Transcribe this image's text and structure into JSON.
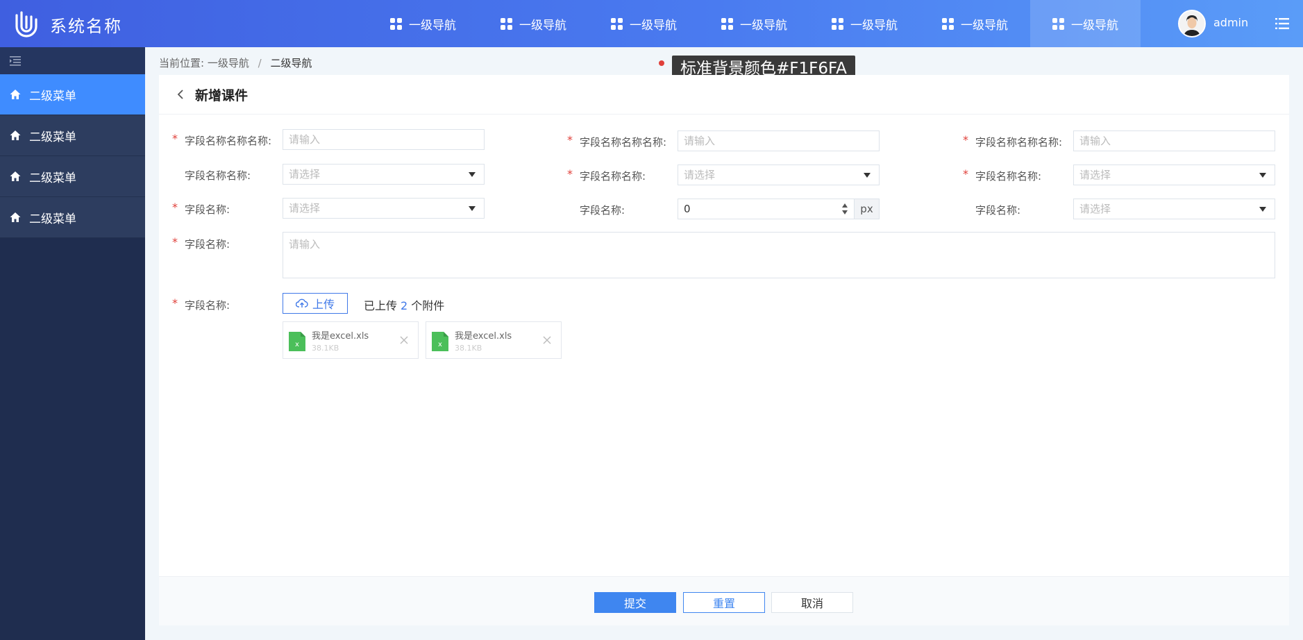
{
  "header": {
    "app_title": "系统名称",
    "nav": [
      {
        "label": "一级导航"
      },
      {
        "label": "一级导航"
      },
      {
        "label": "一级导航"
      },
      {
        "label": "一级导航"
      },
      {
        "label": "一级导航"
      },
      {
        "label": "一级导航"
      },
      {
        "label": "一级导航",
        "active": true
      }
    ],
    "username": "admin"
  },
  "sidebar": {
    "items": [
      {
        "label": "二级菜单",
        "active": true
      },
      {
        "label": "二级菜单"
      },
      {
        "label": "二级菜单"
      },
      {
        "label": "二级菜单"
      }
    ]
  },
  "breadcrumb": {
    "prefix": "当前位置:",
    "level1": "一级导航",
    "separator": "/",
    "current": "二级导航"
  },
  "annotation": {
    "text": "标准背景颜色#F1F6FA"
  },
  "page": {
    "title": "新增课件"
  },
  "form": {
    "row1": [
      {
        "label": "字段名称名称名称:",
        "placeholder": "请输入",
        "required": true
      },
      {
        "label": "字段名称名称名称:",
        "placeholder": "请输入",
        "required": true
      },
      {
        "label": "字段名称名称名称:",
        "placeholder": "请输入",
        "required": true
      }
    ],
    "row2": [
      {
        "label": "字段名称名称:",
        "placeholder": "请选择",
        "required": false
      },
      {
        "label": "字段名称名称:",
        "placeholder": "请选择",
        "required": true
      },
      {
        "label": "字段名称名称:",
        "placeholder": "请选择",
        "required": true
      }
    ],
    "row3": [
      {
        "label": "字段名称:",
        "placeholder": "请选择",
        "required": true
      },
      {
        "label": "字段名称:",
        "value": "0",
        "unit": "px",
        "required": false
      },
      {
        "label": "字段名称:",
        "placeholder": "请选择",
        "required": false
      }
    ],
    "textarea": {
      "label": "字段名称:",
      "placeholder": "请输入",
      "required": true
    },
    "upload": {
      "label": "字段名称:",
      "required": true,
      "button_label": "上传",
      "info_prefix": "已上传",
      "count": "2",
      "info_suffix": "个附件",
      "files": [
        {
          "name": "我是excel.xls",
          "size": "38.1KB",
          "icon_label": "x"
        },
        {
          "name": "我是excel.xls",
          "size": "38.1KB",
          "icon_label": "x"
        }
      ]
    }
  },
  "footer": {
    "submit": "提交",
    "reset": "重置",
    "cancel": "取消"
  },
  "colors": {
    "background": "#F1F6FA",
    "primary": "#3F86F0",
    "sidebar": "#1F2D4F",
    "required": "#E0403A"
  }
}
